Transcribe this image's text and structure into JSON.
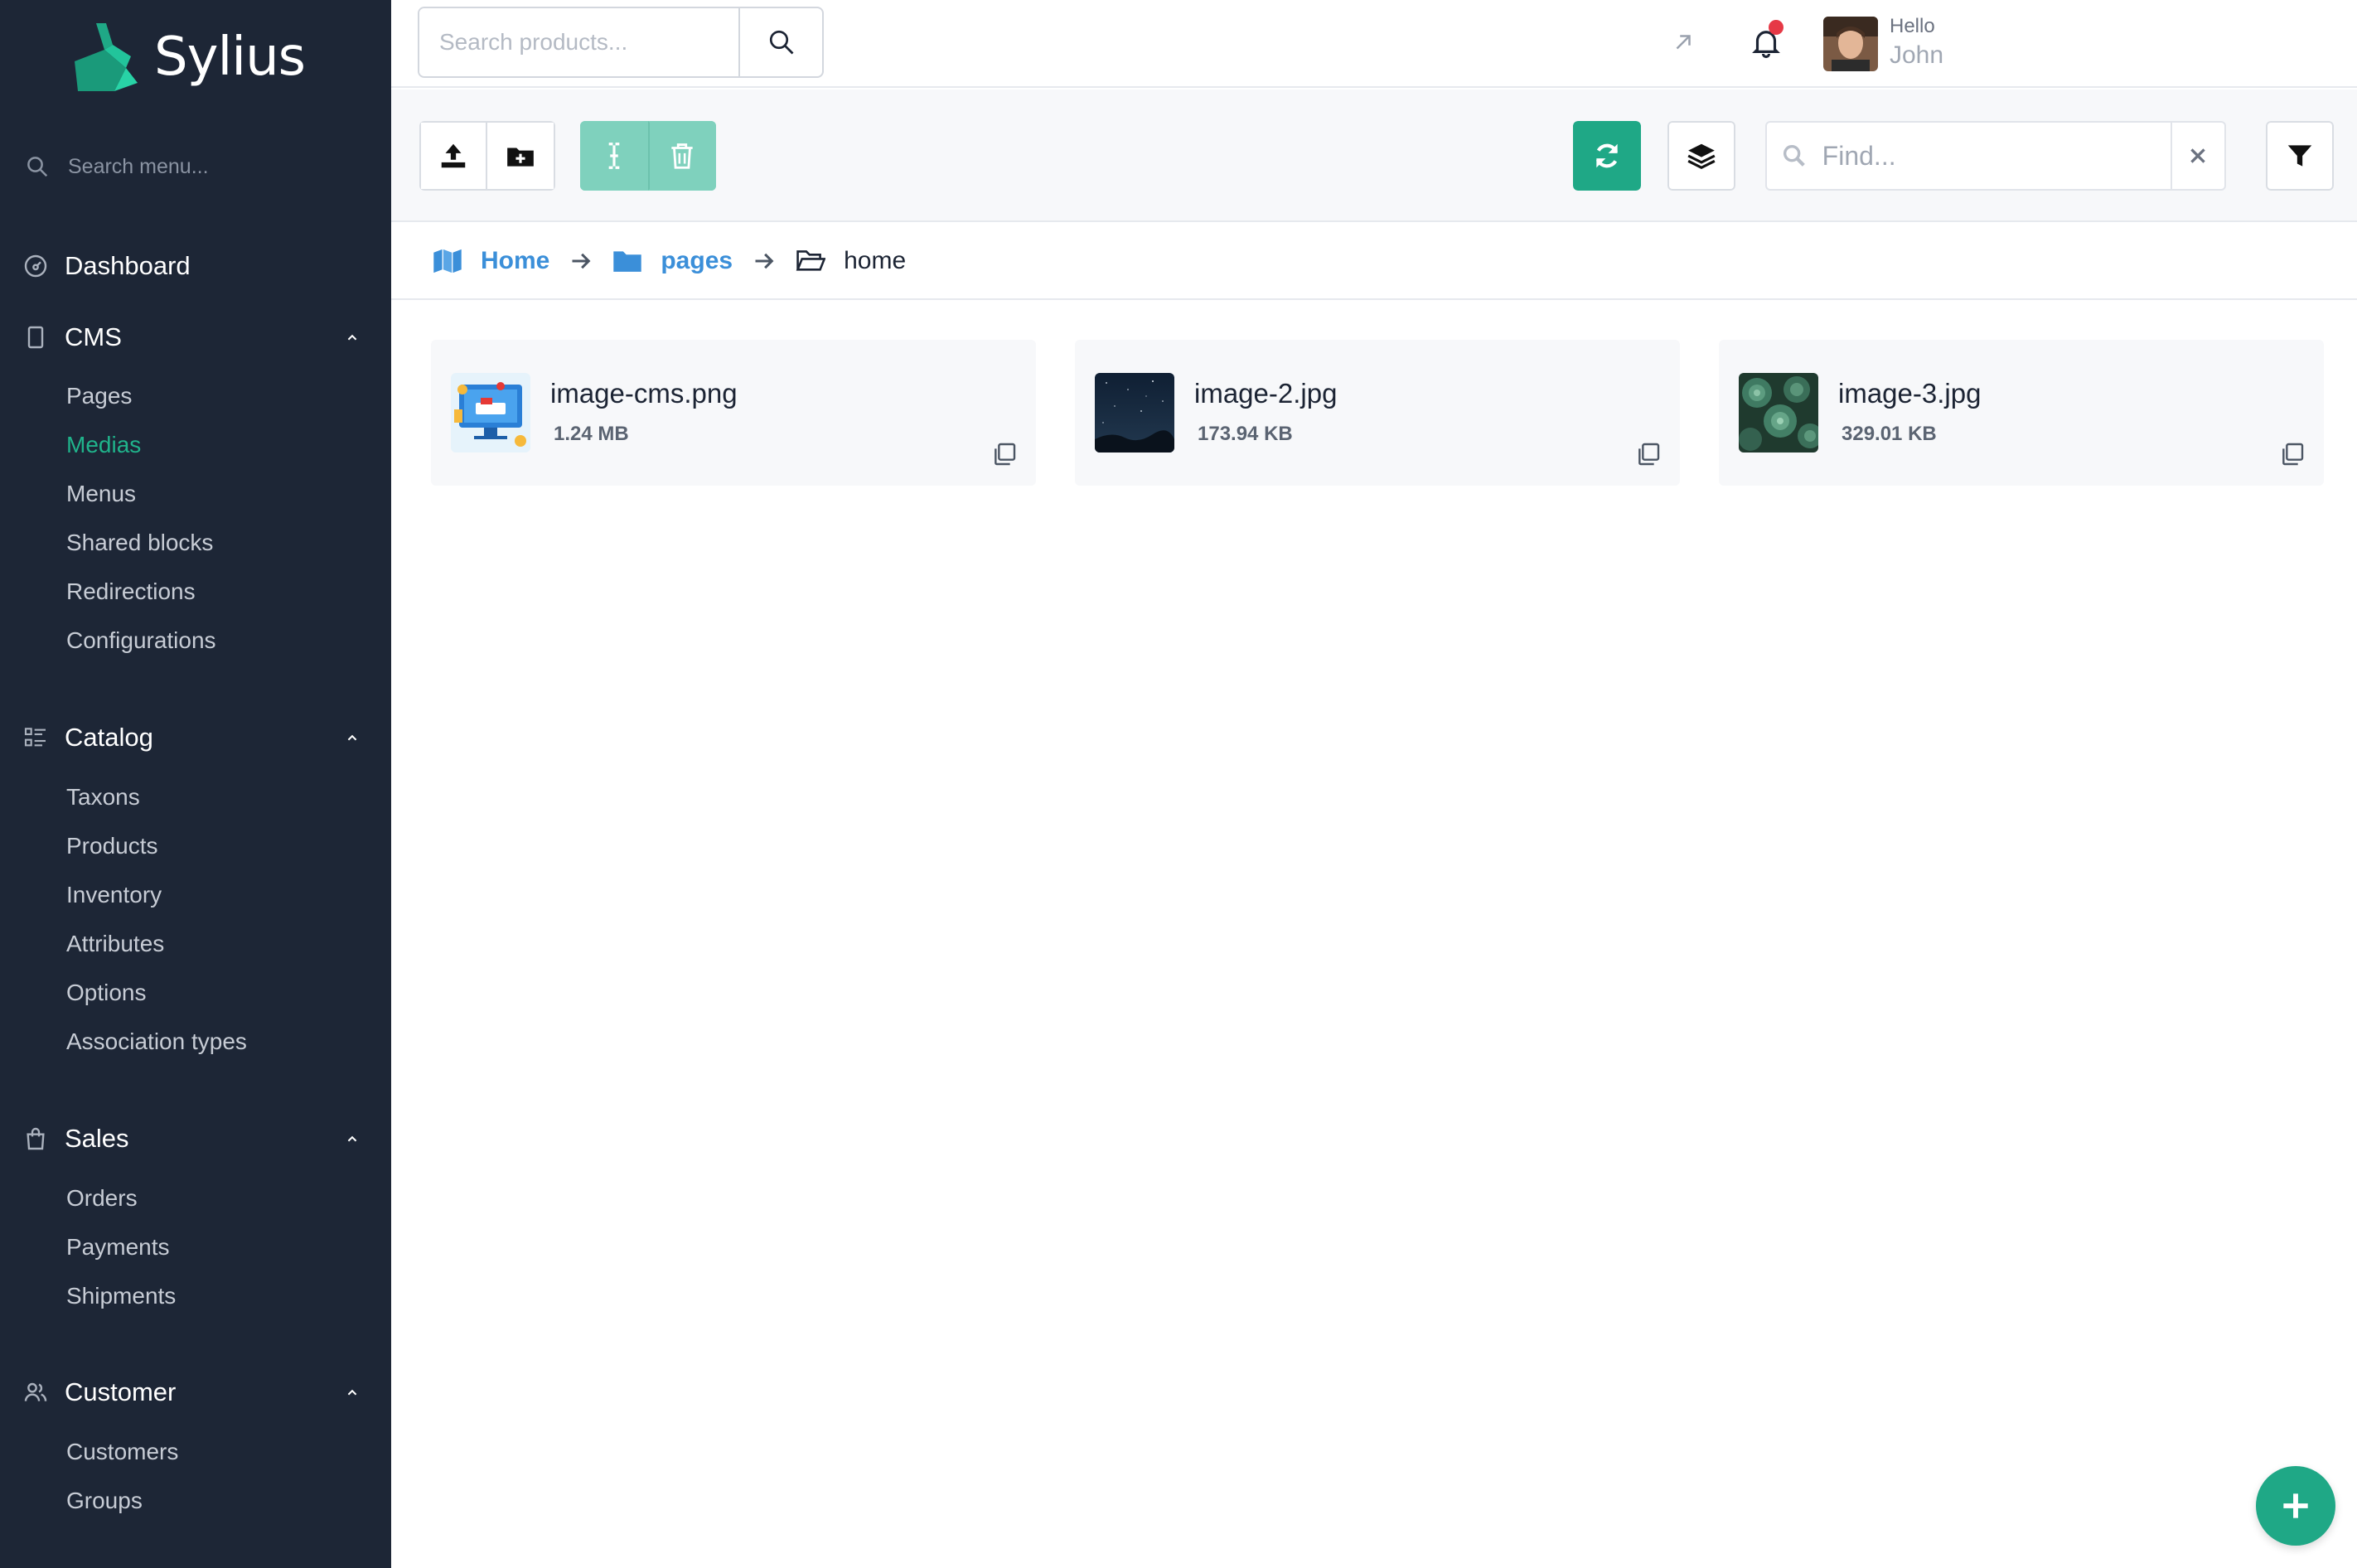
{
  "brand": {
    "name": "Sylius",
    "accent": "#1fa886"
  },
  "sidebar": {
    "search_placeholder": "Search menu...",
    "dashboard": {
      "label": "Dashboard",
      "icon": "dashboard-icon"
    },
    "sections": [
      {
        "label": "CMS",
        "icon": "file-icon",
        "expanded": true,
        "items": [
          "Pages",
          "Medias",
          "Menus",
          "Shared blocks",
          "Redirections",
          "Configurations"
        ],
        "active": "Medias"
      },
      {
        "label": "Catalog",
        "icon": "list-icon",
        "expanded": true,
        "items": [
          "Taxons",
          "Products",
          "Inventory",
          "Attributes",
          "Options",
          "Association types"
        ]
      },
      {
        "label": "Sales",
        "icon": "shopping-bag-icon",
        "expanded": true,
        "items": [
          "Orders",
          "Payments",
          "Shipments"
        ]
      },
      {
        "label": "Customer",
        "icon": "users-icon",
        "expanded": true,
        "items": [
          "Customers",
          "Groups"
        ]
      }
    ]
  },
  "topbar": {
    "search_placeholder": "Search products...",
    "user": {
      "greeting": "Hello",
      "name": "John"
    },
    "notification_dot_color": "#e63946"
  },
  "toolbar": {
    "find_placeholder": "Find..."
  },
  "breadcrumb": {
    "items": [
      {
        "label": "Home",
        "icon": "map-icon"
      },
      {
        "label": "pages",
        "icon": "folder-icon"
      }
    ],
    "current": {
      "label": "home",
      "icon": "folder-open-icon"
    }
  },
  "media": {
    "files": [
      {
        "name": "image-cms.png",
        "size": "1.24 MB",
        "thumbnail": "cms-illustration"
      },
      {
        "name": "image-2.jpg",
        "size": "173.94 KB",
        "thumbnail": "night-sky"
      },
      {
        "name": "image-3.jpg",
        "size": "329.01 KB",
        "thumbnail": "succulents"
      }
    ]
  }
}
